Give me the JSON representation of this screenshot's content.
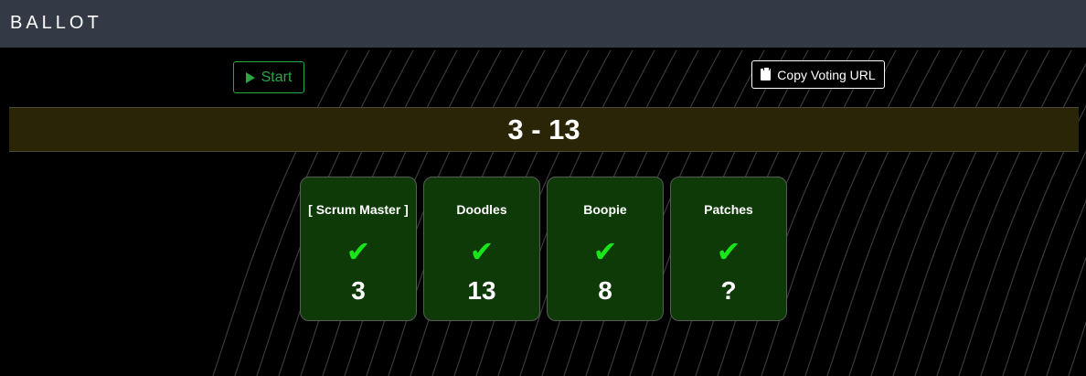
{
  "header": {
    "brand": "BALLOT"
  },
  "controls": {
    "start_label": "Start",
    "copy_label": "Copy Voting URL"
  },
  "result": {
    "text": "3 - 13"
  },
  "cards": [
    {
      "name": "[ Scrum Master ]",
      "check": "✔",
      "vote": "3"
    },
    {
      "name": "Doodles",
      "check": "✔",
      "vote": "13"
    },
    {
      "name": "Boopie",
      "check": "✔",
      "vote": "8"
    },
    {
      "name": "Patches",
      "check": "✔",
      "vote": "?"
    }
  ],
  "colors": {
    "header_bg": "#343a45",
    "start_green": "#28a745",
    "result_bg": "#2b2508",
    "card_bg": "#0e3a08",
    "check_green": "#19e619"
  }
}
